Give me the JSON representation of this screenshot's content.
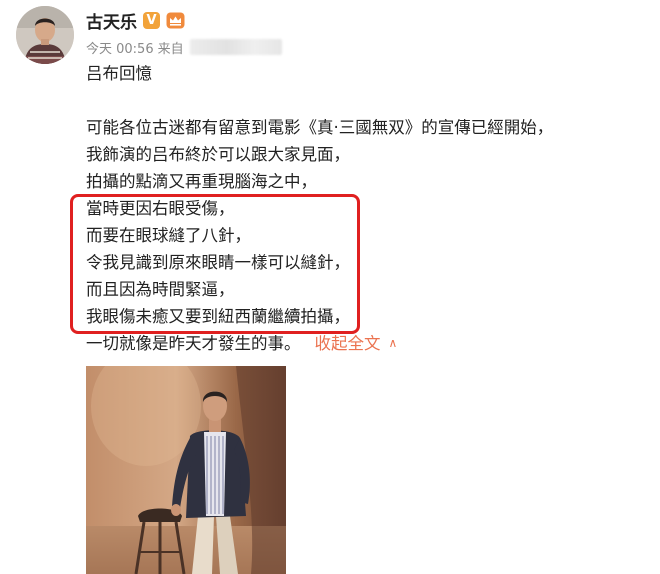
{
  "author": {
    "name": "古天乐",
    "verified_badge": "V",
    "member_icon": "vip-crown-icon"
  },
  "meta": {
    "time": "今天 00:56",
    "source_prefix": "来自"
  },
  "post": {
    "title_line": "吕布回憶",
    "lines": [
      "可能各位古迷都有留意到電影《真·三國無双》的宣傳已經開始，",
      "我飾演的吕布終於可以跟大家見面，",
      "拍攝的點滴又再重現腦海之中，",
      "當時更因右眼受傷，",
      "而要在眼球縫了八針，",
      "令我見識到原來眼睛一樣可以縫針，",
      "而且因為時間緊逼，",
      "我眼傷未癒又要到紐西蘭繼續拍攝，",
      "一切就像是昨天才發生的事。"
    ],
    "collapse_label": "收起全文",
    "collapse_icon": "chevron-up-icon"
  },
  "colors": {
    "link": "#eb7350",
    "highlight": "#e02020",
    "badge": "#f2a33a"
  }
}
